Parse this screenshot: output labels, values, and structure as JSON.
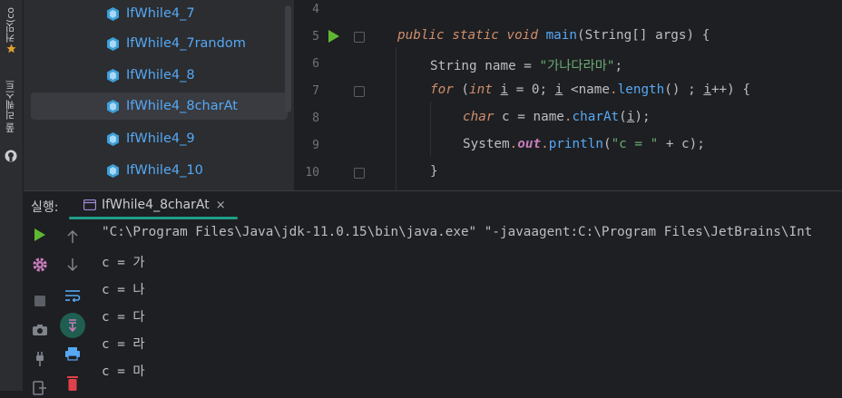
{
  "side_strip": {
    "top_label": "커밋(co",
    "bottom_label": "풀 리퀘스트"
  },
  "project_tree": {
    "items": [
      {
        "label": "IfWhile4_7",
        "selected": false
      },
      {
        "label": "IfWhile4_7random",
        "selected": false
      },
      {
        "label": "IfWhile4_8",
        "selected": false
      },
      {
        "label": "IfWhile4_8charAt",
        "selected": true
      },
      {
        "label": "IfWhile4_9",
        "selected": false
      },
      {
        "label": "IfWhile4_10",
        "selected": false
      }
    ]
  },
  "editor": {
    "line_numbers": [
      "4",
      "5",
      "6",
      "7",
      "8",
      "9",
      "10"
    ],
    "lines": {
      "l5": {
        "kw_public": "public",
        "kw_static": "static",
        "kw_void": "void",
        "fn": "main",
        "open": "(String[] ",
        "param": "args",
        "close": ") {"
      },
      "l6": {
        "type": "String name = ",
        "str": "\"가나다라마\"",
        "end": ";"
      },
      "l7": {
        "kw_for": "for",
        "a": " (",
        "kw_int": "int",
        "b": " ",
        "i1": "i",
        "c": " = 0; ",
        "i2": "i",
        "d": " <name",
        "dot": ".",
        "fn": "length",
        "e": "() ; ",
        "i3": "i",
        "f": "++) {"
      },
      "l8": {
        "kw_char": "char",
        "a": " c = name",
        "dot": ".",
        "fn": "charAt",
        "b": "(",
        "i": "i",
        "c": ");"
      },
      "l9": {
        "a": "System",
        "dot1": ".",
        "out": "out",
        "dot2": ".",
        "fn": "println",
        "b": "(",
        "str": "\"c = \"",
        "c": " + c);"
      },
      "l10": {
        "a": "}"
      }
    }
  },
  "run_panel": {
    "label": "실행:",
    "tab_label": "IfWhile4_8charAt",
    "tab_close": "×",
    "console_lines": [
      "\"C:\\Program Files\\Java\\jdk-11.0.15\\bin\\java.exe\" \"-javaagent:C:\\Program Files\\JetBrains\\Int",
      "c = 가",
      "c = 나",
      "c = 다",
      "c = 라",
      "c = 마"
    ]
  },
  "colors": {
    "accent_green": "#1f9e89",
    "keyword": "#cf8e6d",
    "function": "#56a8f5",
    "string": "#6aab73",
    "run_green": "#5fb832"
  }
}
